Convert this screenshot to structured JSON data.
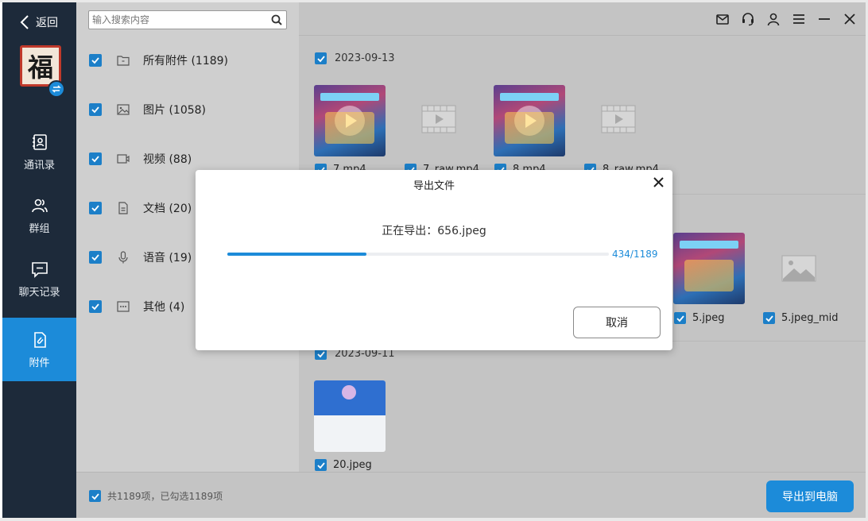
{
  "nav": {
    "back_label": "返回",
    "avatar_char": "福",
    "items": [
      {
        "label": "通讯录",
        "icon": "contacts-icon"
      },
      {
        "label": "群组",
        "icon": "group-icon"
      },
      {
        "label": "聊天记录",
        "icon": "chat-icon"
      },
      {
        "label": "附件",
        "icon": "attachment-icon",
        "active": true
      }
    ]
  },
  "search": {
    "placeholder": "输入搜索内容"
  },
  "categories": [
    {
      "label": "所有附件 (1189)",
      "icon": "folder-icon",
      "checked": true
    },
    {
      "label": "图片 (1058)",
      "icon": "image-icon",
      "checked": true
    },
    {
      "label": "视频 (88)",
      "icon": "video-icon",
      "checked": true
    },
    {
      "label": "文档 (20)",
      "icon": "document-icon",
      "checked": true
    },
    {
      "label": "语音 (19)",
      "icon": "microphone-icon",
      "checked": true
    },
    {
      "label": "其他 (4)",
      "icon": "more-icon",
      "checked": true
    }
  ],
  "topbar_icons": [
    "mail-icon",
    "headset-icon",
    "user-icon",
    "menu-icon",
    "minimize-icon",
    "close-icon"
  ],
  "groups": [
    {
      "date": "2023-09-13",
      "files": [
        {
          "name": "7.mp4",
          "kind": "video-thumb"
        },
        {
          "name": "7_raw.mp4",
          "kind": "video-placeholder"
        },
        {
          "name": "8.mp4",
          "kind": "video-thumb"
        },
        {
          "name": "8_raw.mp4",
          "kind": "video-placeholder"
        }
      ]
    },
    {
      "date": "",
      "files": [
        {
          "name": "5.jpeg",
          "kind": "image-thumb"
        },
        {
          "name": "5.jpeg_mid",
          "kind": "image-placeholder"
        }
      ]
    },
    {
      "date": "2023-09-11",
      "files": [
        {
          "name": "20.jpeg",
          "kind": "screenshot-thumb"
        }
      ]
    }
  ],
  "footer": {
    "summary": "共1189项，已勾选1189项",
    "export_label": "导出到电脑"
  },
  "modal": {
    "title": "导出文件",
    "status": "正在导出：656.jpeg",
    "progress": {
      "done": 434,
      "total": 1189,
      "text": "434/1189"
    },
    "cancel_label": "取消"
  },
  "colors": {
    "accent": "#1c8bd9",
    "nav_bg": "#1d2a3a",
    "checkbox": "#1c7fc8"
  }
}
